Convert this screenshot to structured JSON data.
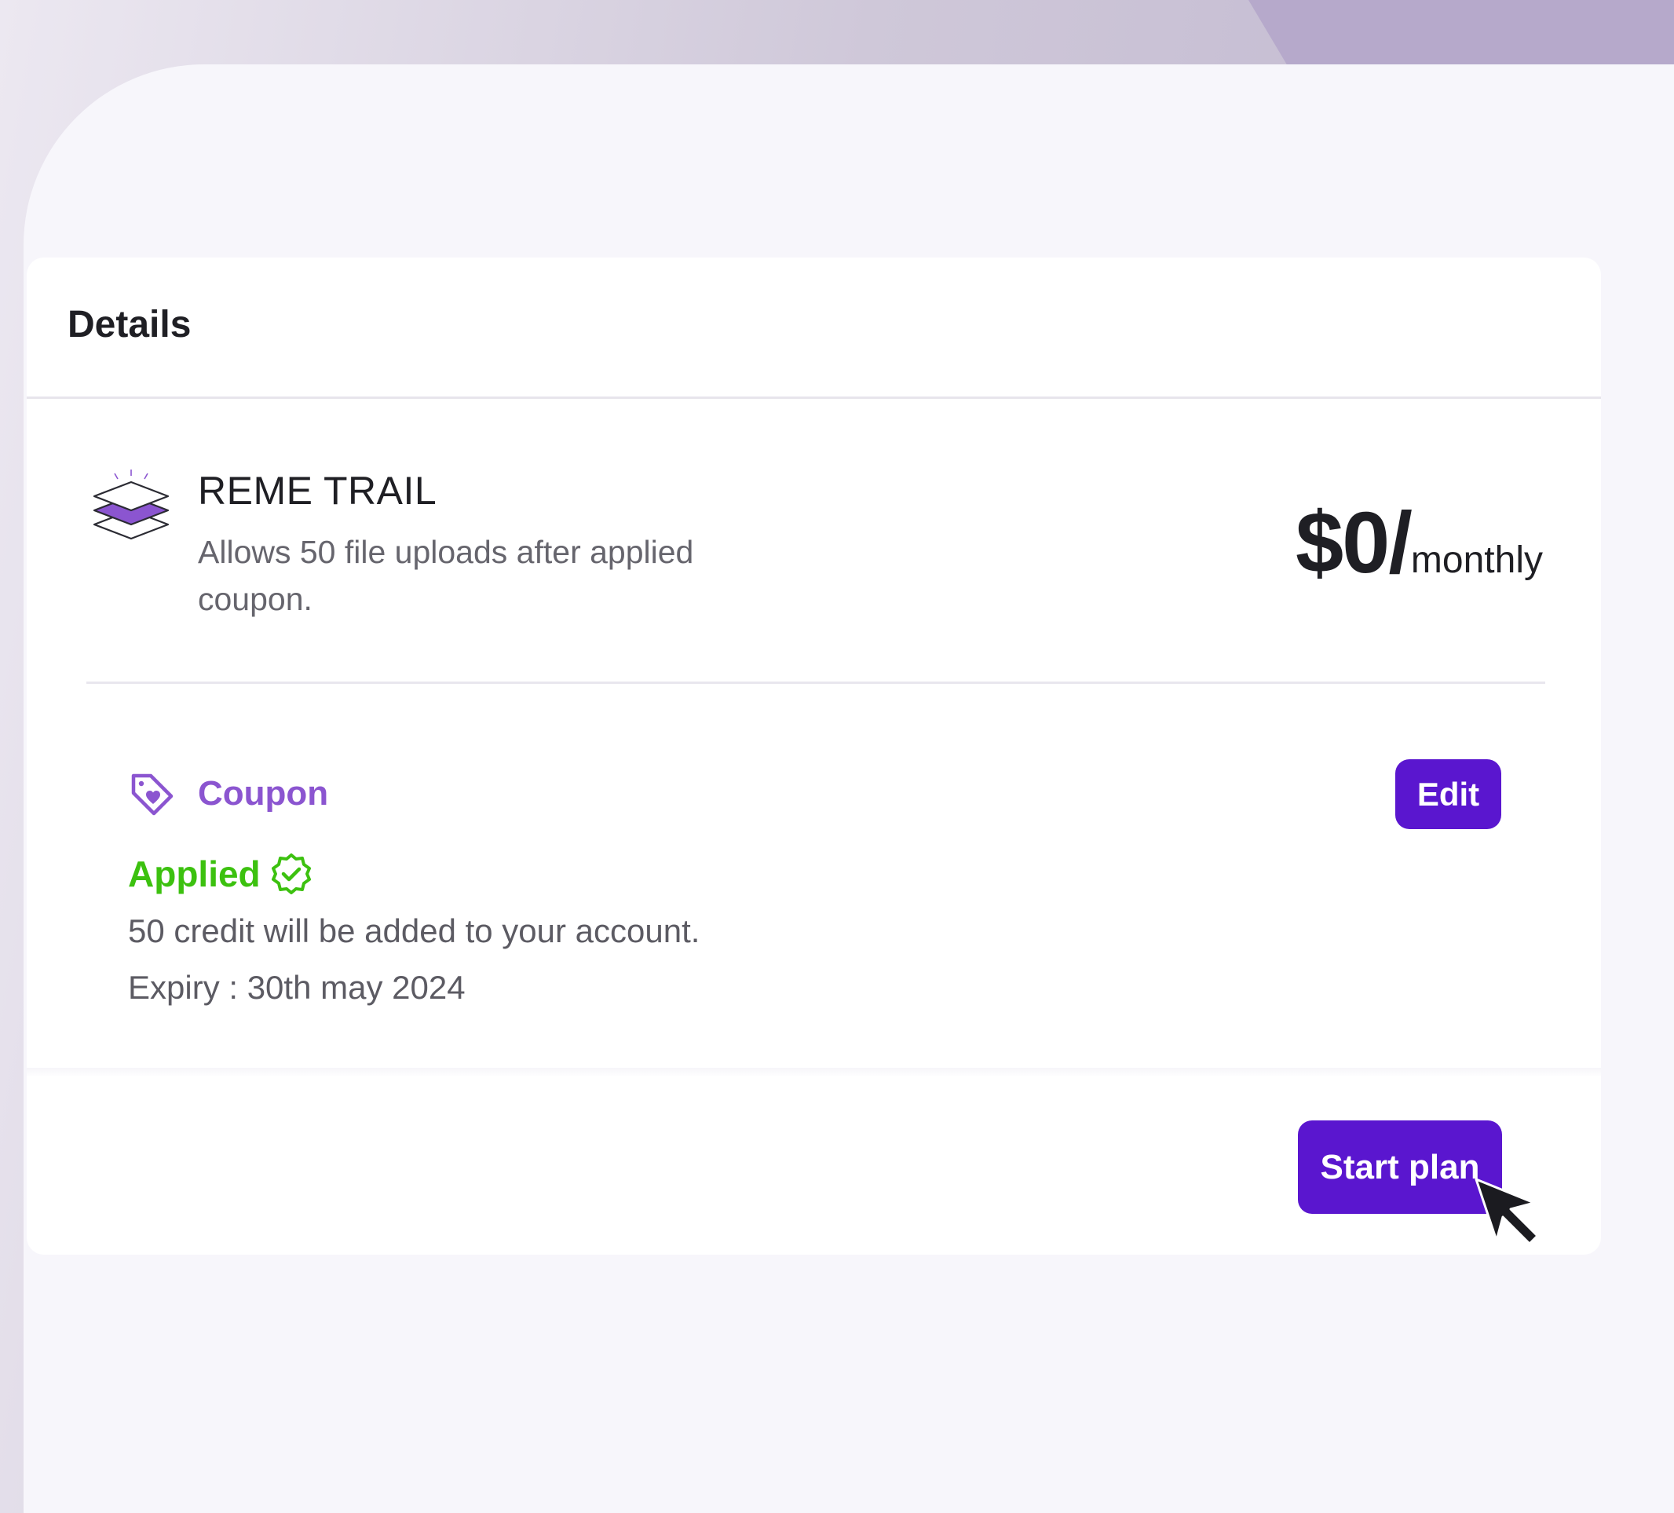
{
  "details": {
    "title": "Details"
  },
  "plan": {
    "icon": "layers-icon",
    "name": "REME TRAIL",
    "description": "Allows 50 file uploads after applied coupon.",
    "price": "$0/",
    "period": "monthly"
  },
  "coupon": {
    "icon": "tag-heart-icon",
    "label": "Coupon",
    "edit_label": "Edit",
    "status": "Applied",
    "status_icon": "verified-check-icon",
    "credit_text": "50 credit will be added to your account.",
    "expiry_text": "Expiry : 30th may 2024"
  },
  "footer": {
    "start_label": "Start plan"
  },
  "colors": {
    "accent": "#5a16cf",
    "coupon": "#8b55d0",
    "success": "#3cc10f"
  }
}
